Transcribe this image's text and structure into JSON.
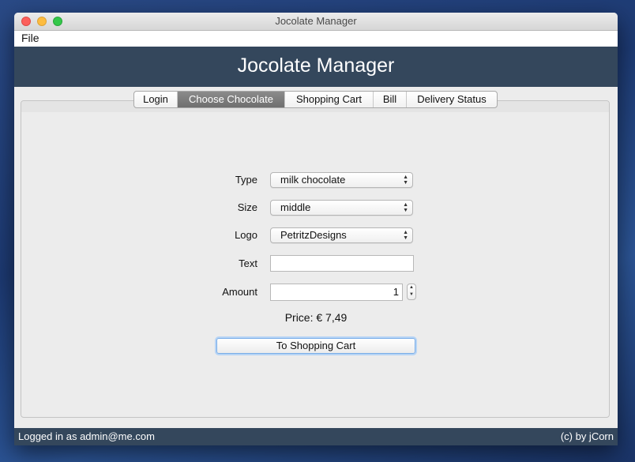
{
  "window": {
    "title": "Jocolate Manager"
  },
  "menu": {
    "items": [
      "File"
    ]
  },
  "header": {
    "title": "Jocolate Manager"
  },
  "tabs": [
    {
      "label": "Login",
      "active": false
    },
    {
      "label": "Choose Chocolate",
      "active": true
    },
    {
      "label": "Shopping Cart",
      "active": false
    },
    {
      "label": "Bill",
      "active": false
    },
    {
      "label": "Delivery Status",
      "active": false
    }
  ],
  "form": {
    "type": {
      "label": "Type",
      "value": "milk chocolate"
    },
    "size": {
      "label": "Size",
      "value": "middle"
    },
    "logo": {
      "label": "Logo",
      "value": "PetritzDesigns"
    },
    "text": {
      "label": "Text",
      "value": ""
    },
    "amount": {
      "label": "Amount",
      "value": "1"
    },
    "price": "Price: € 7,49",
    "button": "To Shopping Cart"
  },
  "status": {
    "left": "Logged in as admin@me.com",
    "right": "(c) by jCorn"
  },
  "colors": {
    "header_bg": "#34475c",
    "active_tab": "#7a7a7a",
    "focus_ring": "#7aaee8"
  }
}
